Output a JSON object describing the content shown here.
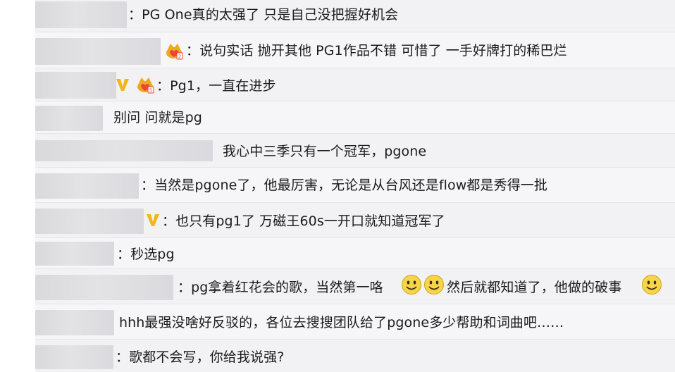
{
  "comments": [
    {
      "text": "：PG One真的太强了 只是自己没把握好机会"
    },
    {
      "text": "：说句实话  抛开其他  PG1作品不错  可惜了  一手好牌打的稀巴烂"
    },
    {
      "text": "：Pg1，一直在进步"
    },
    {
      "text": "别问 问就是pg"
    },
    {
      "text": "我心中三季只有一个冠军，pgone"
    },
    {
      "text": "：当然是pgone了，他最厉害，无论是从台风还是flow都是秀得一批"
    },
    {
      "text": "：也只有pg1了 万磁王60s一开口就知道冠军了"
    },
    {
      "text": "：秒选pg"
    },
    {
      "text_a": "：pg拿着红花会的歌，当然第一咯",
      "text_b": "然后就都知道了，他做的破事"
    },
    {
      "text": "hhh最强没啥好反驳的，各位去搜搜团队给了pgone多少帮助和词曲吧……"
    },
    {
      "text": "：歌都不会写，你给我说强?"
    }
  ],
  "icons": {
    "verified": "verified-v-icon",
    "crown_badge": "crown-badge-icon",
    "emoji_smile": "smile-emoji-icon"
  },
  "colors": {
    "verified_gold": "#f2b61c",
    "crown_gold": "#f0a81e",
    "crown_red": "#e9473b",
    "smile_yellow": "#f6d548"
  }
}
